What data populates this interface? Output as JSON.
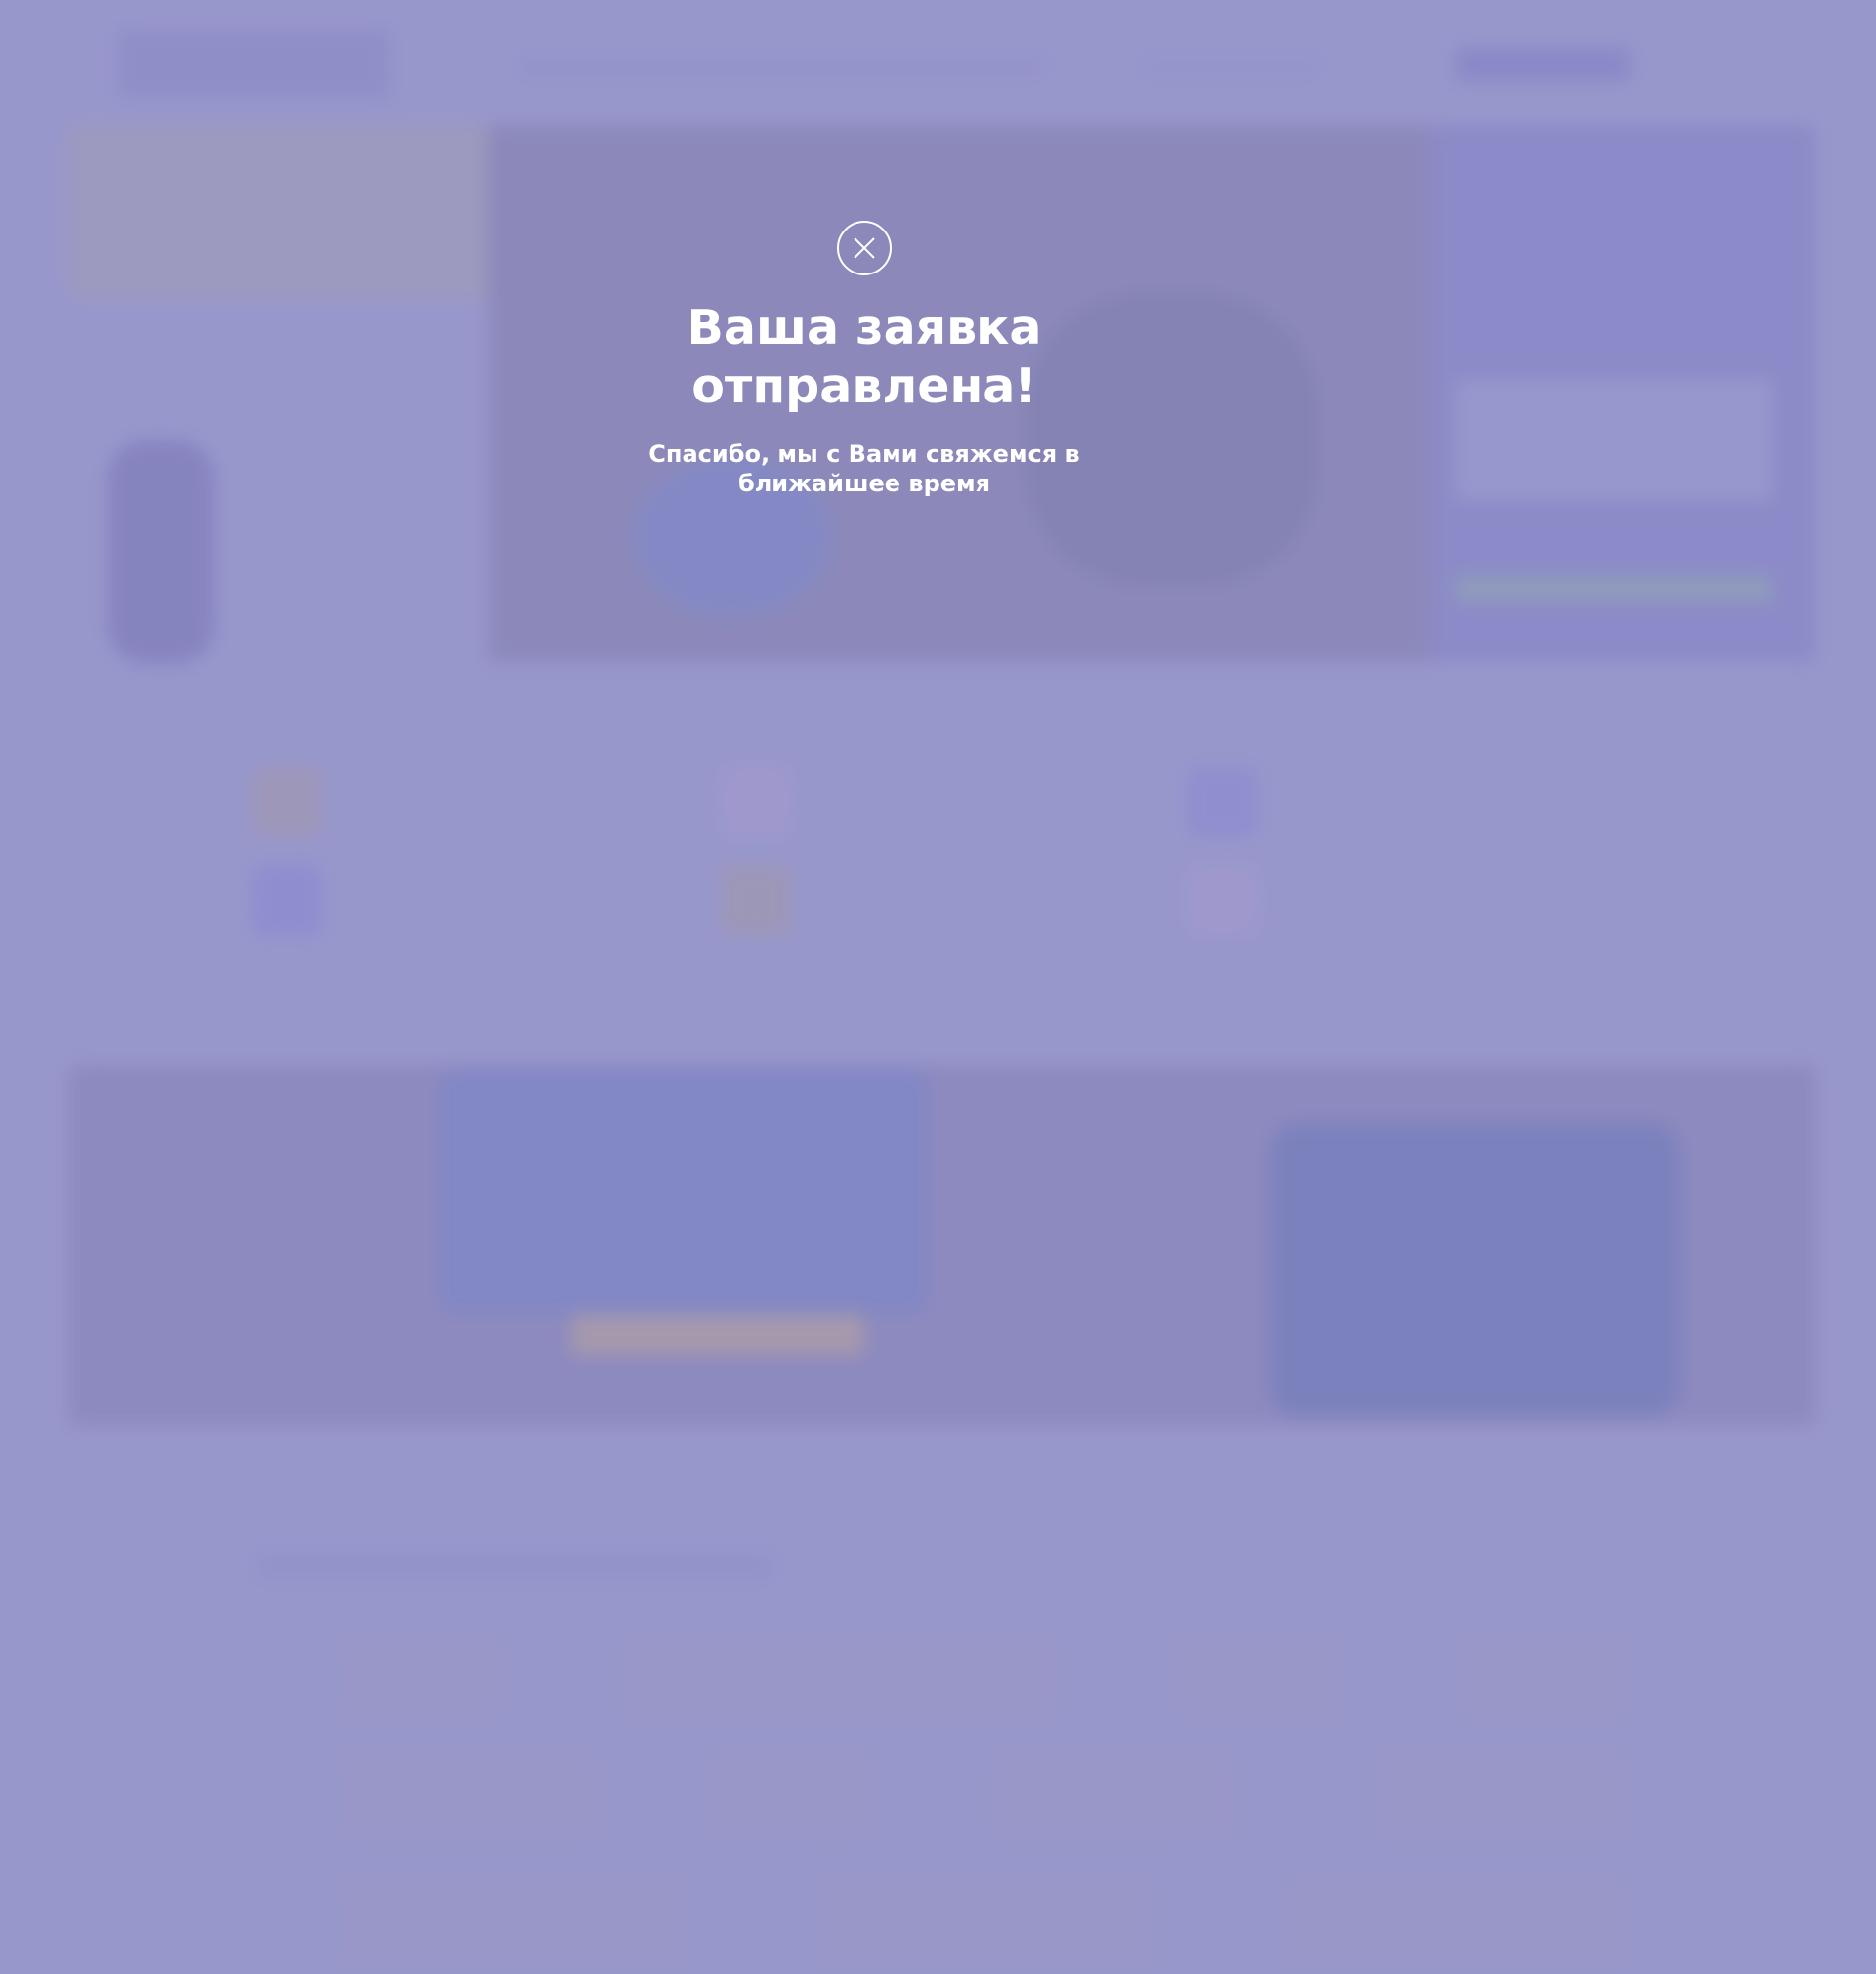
{
  "modal": {
    "close_icon": "close-icon",
    "title_line1": "Ваша заявка",
    "title_line2": "отправлена!",
    "subtitle": "Спасибо, мы с Вами свяжемся в ближайшее время"
  },
  "colors": {
    "overlay": "#9d9ccc",
    "modal_text": "#ffffff"
  }
}
